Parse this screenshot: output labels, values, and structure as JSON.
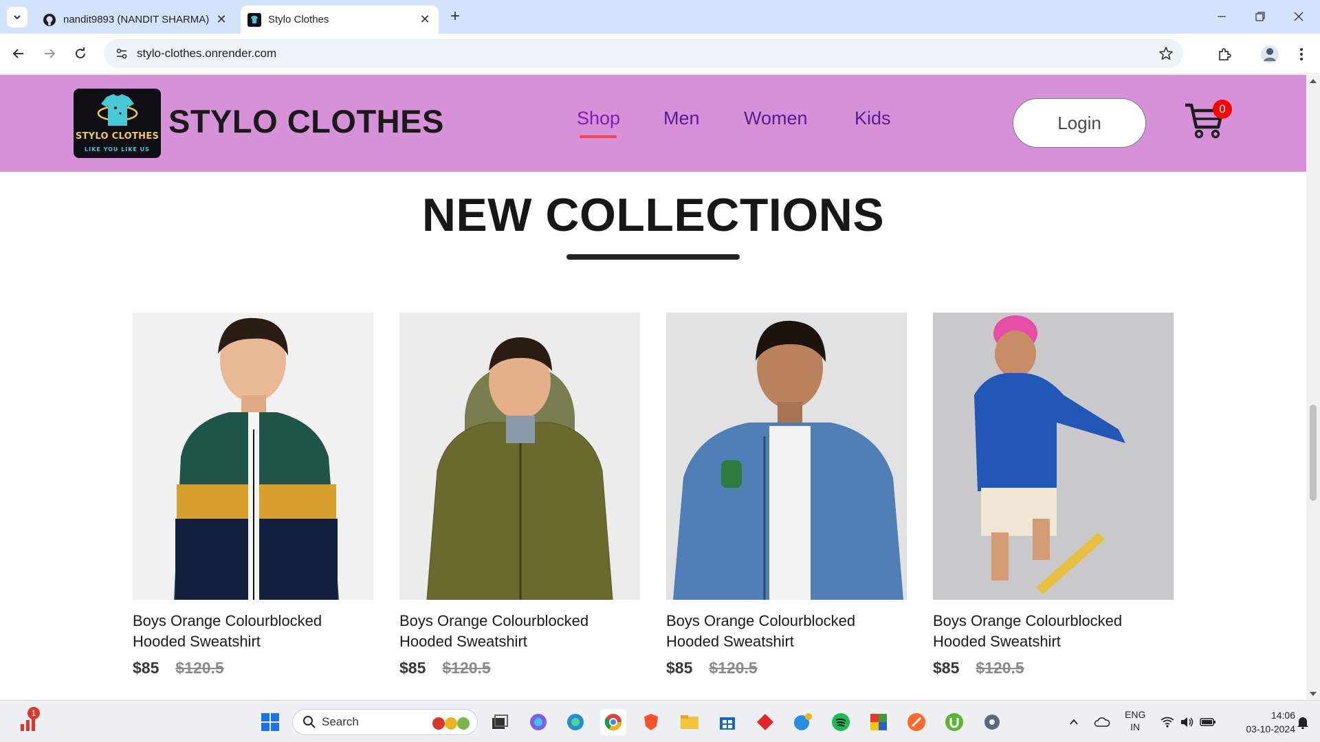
{
  "browser": {
    "tabs": [
      {
        "title": "nandit9893 (NANDIT SHARMA)",
        "active": false,
        "icon": "github-icon"
      },
      {
        "title": "Stylo Clothes",
        "active": true,
        "icon": "site-favicon"
      }
    ],
    "url": "stylo-clothes.onrender.com"
  },
  "site": {
    "logo": {
      "line1": "STYLO CLOTHES",
      "line2": "LIKE YOU LIKE US"
    },
    "brand": "STYLO CLOTHES",
    "menu": [
      "Shop",
      "Men",
      "Women",
      "Kids"
    ],
    "active_menu": "Shop",
    "login_label": "Login",
    "cart_count": "0",
    "accent_color": "#d691d8"
  },
  "section": {
    "title": "NEW COLLECTIONS"
  },
  "products": [
    {
      "name": "Boys Orange Colourblocked Hooded Sweatshirt",
      "new_price": "$85",
      "old_price": "$120.5",
      "image": "boy-in-green-colourblock-jacket"
    },
    {
      "name": "Boys Orange Colourblocked Hooded Sweatshirt",
      "new_price": "$85",
      "old_price": "$120.5",
      "image": "boy-in-olive-quilted-jacket"
    },
    {
      "name": "Boys Orange Colourblocked Hooded Sweatshirt",
      "new_price": "$85",
      "old_price": "$120.5",
      "image": "boy-in-denim-jacket"
    },
    {
      "name": "Boys Orange Colourblocked Hooded Sweatshirt",
      "new_price": "$85",
      "old_price": "$120.5",
      "image": "boy-in-blue-sweatshirt-on-skateboard"
    }
  ],
  "taskbar": {
    "search_label": "Search",
    "notification_badge": "1",
    "lang_line1": "ENG",
    "lang_line2": "IN",
    "time": "14:06",
    "date": "03-10-2024"
  }
}
